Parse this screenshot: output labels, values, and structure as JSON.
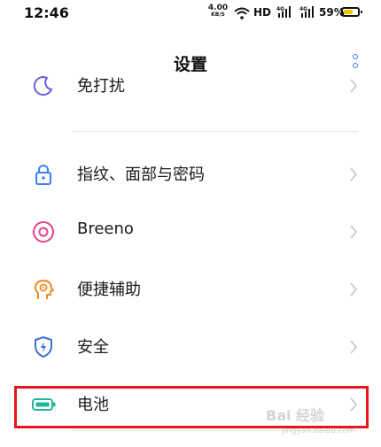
{
  "status_bar": {
    "time": "12:46",
    "net_speed_value": "4.00",
    "net_speed_unit": "KB/S",
    "hd_label": "HD",
    "battery_percent": "59%",
    "battery_color": "#f2c400"
  },
  "header": {
    "title": "设置",
    "accent_color": "#3b7ff5"
  },
  "settings_items": [
    {
      "label": "免打扰",
      "icon": "moon-icon"
    },
    {
      "label": "指纹、面部与密码",
      "icon": "lock-icon"
    },
    {
      "label": "Breeno",
      "icon": "breeno-icon"
    },
    {
      "label": "便捷辅助",
      "icon": "accessibility-icon"
    },
    {
      "label": "安全",
      "icon": "shield-icon"
    },
    {
      "label": "电池",
      "icon": "battery-icon"
    }
  ],
  "highlight_color": "#e5171c",
  "watermark": {
    "text": "Bai 经验",
    "sub": "jingyan.baidu.com"
  }
}
